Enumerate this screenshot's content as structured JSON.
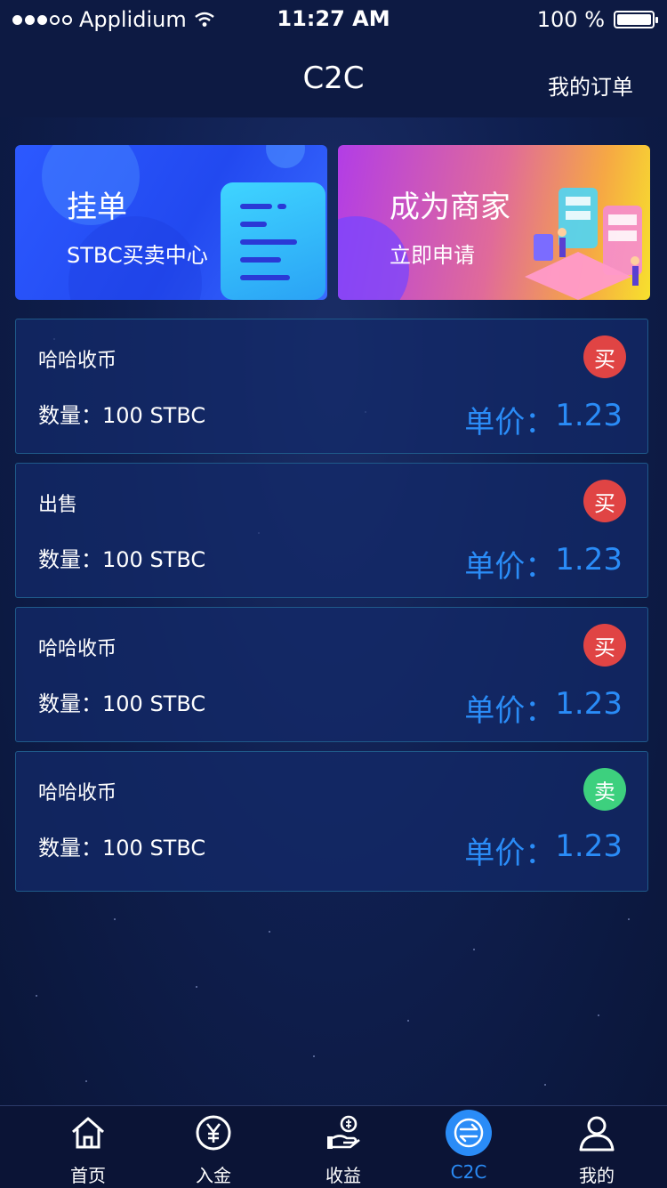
{
  "status_bar": {
    "carrier": "Applidium",
    "time": "11:27 AM",
    "battery": "100 %"
  },
  "nav": {
    "title": "C2C",
    "right_link": "我的订单"
  },
  "banners": [
    {
      "title": "挂单",
      "subtitle": "STBC买卖中心"
    },
    {
      "title": "成为商家",
      "subtitle": "立即申请"
    }
  ],
  "orders": [
    {
      "name": "哈哈收币",
      "qty_label": "数量：",
      "qty": "100 STBC",
      "price_label": "单价：",
      "price": "1.23",
      "badge": "买",
      "badge_type": "buy"
    },
    {
      "name": "出售",
      "qty_label": "数量：",
      "qty": "100 STBC",
      "price_label": "单价：",
      "price": "1.23",
      "badge": "买",
      "badge_type": "buy"
    },
    {
      "name": "哈哈收币",
      "qty_label": "数量：",
      "qty": "100 STBC",
      "price_label": "单价：",
      "price": "1.23",
      "badge": "买",
      "badge_type": "buy"
    },
    {
      "name": "哈哈收币",
      "qty_label": "数量：",
      "qty": "100 STBC",
      "price_label": "单价：",
      "price": "1.23",
      "badge": "卖",
      "badge_type": "sell"
    }
  ],
  "tabs": [
    {
      "label": "首页",
      "icon": "home-icon"
    },
    {
      "label": "入金",
      "icon": "yen-icon"
    },
    {
      "label": "收益",
      "icon": "earnings-hand-icon"
    },
    {
      "label": "C2C",
      "icon": "exchange-icon",
      "active": true
    },
    {
      "label": "我的",
      "icon": "user-icon"
    }
  ],
  "colors": {
    "accent": "#2a8cf7",
    "buy": "#e04444",
    "sell": "#3dd07e",
    "background": "#0f1f4f"
  }
}
